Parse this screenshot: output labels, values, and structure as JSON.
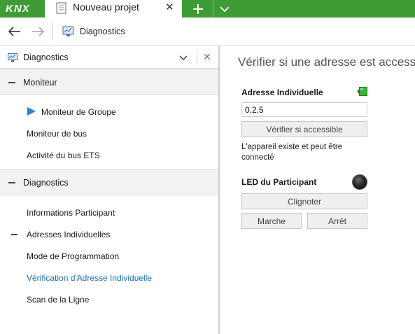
{
  "app": {
    "logo_text": "KNX",
    "document_tab": "Nouveau projet",
    "close_glyph": "✕",
    "colors": {
      "brand_green": "#3f9b35",
      "link_blue": "#1a6fb5",
      "play_blue": "#2a7fd4"
    }
  },
  "navbar": {
    "breadcrumb": "Diagnostics"
  },
  "panel": {
    "title": "Diagnostics",
    "close_glyph": "✕"
  },
  "groups": {
    "moniteur": {
      "label": "Moniteur",
      "items": [
        "Moniteur de Groupe",
        "Moniteur de bus",
        "Activité du bus ETS"
      ]
    },
    "diagnostics": {
      "label": "Diagnostics",
      "items": [
        "Informations Participant",
        "Adresses Individuelles",
        "Mode de Programmation",
        "Vérification d'Adresse Individuelle",
        "Scan de la Ligne"
      ],
      "active_item": "Vérification d'Adresse Individuelle"
    }
  },
  "main": {
    "title": "Vérifier si une adresse est accessible",
    "address_label": "Adresse Individuelle",
    "address_value": "0.2.5",
    "verify_button": "Vérifier si accessible",
    "result_text": "L'appareil existe et peut être connecté",
    "status_led_color": "#3ab53a",
    "led_label": "LED du Participant",
    "blink_button": "Clignoter",
    "on_button": "Marche",
    "off_button": "Arrêt"
  }
}
